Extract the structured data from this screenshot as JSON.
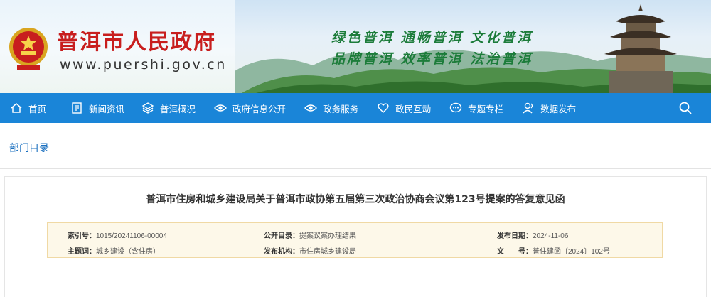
{
  "header": {
    "site_title": "普洱市人民政府",
    "site_url": "www.puershi.gov.cn",
    "slogan_line1": "绿色普洱 通畅普洱 文化普洱",
    "slogan_line2": "品牌普洱 效率普洱 法治普洱"
  },
  "nav": {
    "items": [
      {
        "label": "首页",
        "icon": "home-icon"
      },
      {
        "label": "新闻资讯",
        "icon": "document-icon"
      },
      {
        "label": "普洱概况",
        "icon": "layers-icon"
      },
      {
        "label": "政府信息公开",
        "icon": "eye-icon"
      },
      {
        "label": "政务服务",
        "icon": "eye-icon"
      },
      {
        "label": "政民互动",
        "icon": "heart-icon"
      },
      {
        "label": "专题专栏",
        "icon": "chat-icon"
      },
      {
        "label": "数据发布",
        "icon": "user-icon"
      }
    ],
    "search_icon": "search-icon"
  },
  "breadcrumb": {
    "label": "部门目录"
  },
  "article": {
    "title": "普洱市住房和城乡建设局关于普洱市政协第五届第三次政治协商会议第123号提案的答复意见函",
    "meta": {
      "index_key": "索引号：",
      "index_value": "1015/20241106-00004",
      "catalog_key": "公开目录：",
      "catalog_value": "提案议案办理结果",
      "date_key": "发布日期：",
      "date_value": "2024-11-06",
      "subject_key": "主题词：",
      "subject_value": "城乡建设（含住房）",
      "publisher_key": "发布机构：",
      "publisher_value": "市住房城乡建设局",
      "docno_key": "文　　号：",
      "docno_value": "普住建函〔2024〕102号"
    }
  },
  "colors": {
    "nav_bg": "#1a85d8",
    "title_red": "#c81e1e",
    "slogan_green": "#1c7c3a",
    "breadcrumb_blue": "#1a6fbf",
    "meta_bg": "#fdf8e9",
    "meta_border": "#f0d9a4"
  }
}
